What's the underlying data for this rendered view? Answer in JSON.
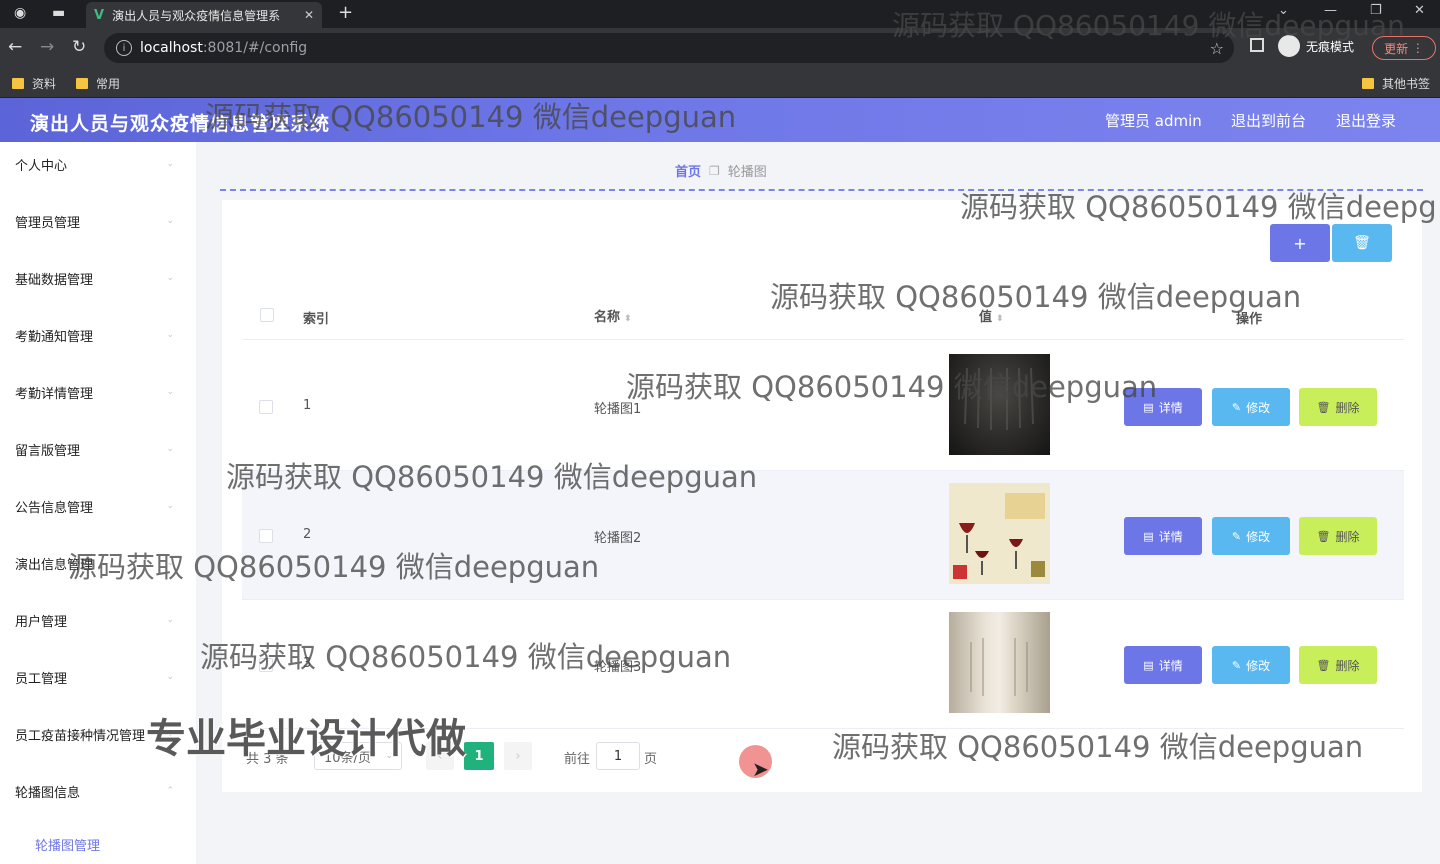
{
  "browser": {
    "tab_title": "演出人员与观众疫情信息管理系",
    "url_host": "localhost",
    "url_path": ":8081/#/config",
    "incognito_label": "无痕模式",
    "update_label": "更新",
    "bookmarks": [
      "资料",
      "常用"
    ],
    "other_bookmarks": "其他书签"
  },
  "header": {
    "title": "演出人员与观众疫情信息管理系统",
    "user": "管理员 admin",
    "to_front": "退出到前台",
    "logout": "退出登录"
  },
  "sidebar": {
    "items": [
      {
        "label": "个人中心"
      },
      {
        "label": "管理员管理"
      },
      {
        "label": "基础数据管理"
      },
      {
        "label": "考勤通知管理"
      },
      {
        "label": "考勤详情管理"
      },
      {
        "label": "留言版管理"
      },
      {
        "label": "公告信息管理"
      },
      {
        "label": "演出信息管理"
      },
      {
        "label": "用户管理"
      },
      {
        "label": "员工管理"
      },
      {
        "label": "员工疫苗接种情况管理"
      },
      {
        "label": "轮播图信息"
      }
    ],
    "sub_item": "轮播图管理"
  },
  "breadcrumb": {
    "home": "首页",
    "current": "轮播图"
  },
  "toolbar": {
    "add_label": "+",
    "delete_icon": "trash-icon"
  },
  "table": {
    "headers": {
      "index": "索引",
      "name": "名称",
      "value": "值",
      "actions": "操作"
    },
    "rows": [
      {
        "index": "1",
        "name": "轮播图1"
      },
      {
        "index": "2",
        "name": "轮播图2"
      },
      {
        "index": "3",
        "name": "轮播图3"
      }
    ],
    "actions": {
      "detail": "详情",
      "edit": "修改",
      "delete": "删除"
    }
  },
  "pagination": {
    "total": "共 3 条",
    "page_size": "10条/页",
    "current_page": "1",
    "goto_label": "前往",
    "goto_value": "1",
    "page_suffix": "页"
  },
  "watermarks": {
    "line": "源码获取 QQ86050149 微信deepguan",
    "cut_line": "源码获取 QQ86050149 微信deepg",
    "big": "专业毕业设计代做"
  },
  "colors": {
    "primary": "#6d76e6",
    "info": "#5ab8f0",
    "danger": "#c8ef5a",
    "pager_active": "#1fb27c"
  }
}
